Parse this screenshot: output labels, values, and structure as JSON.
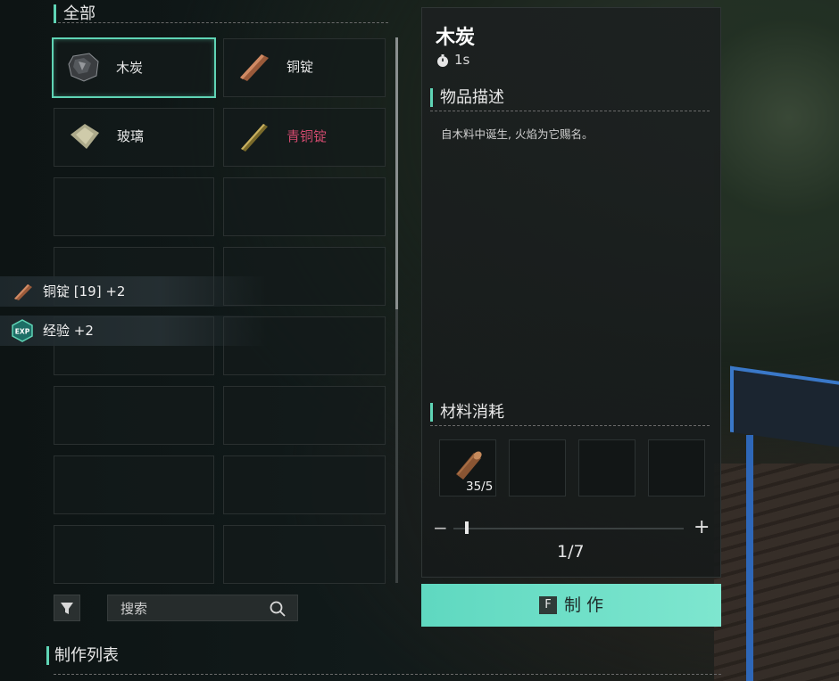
{
  "category": {
    "title": "全部"
  },
  "items": [
    {
      "label": "木炭",
      "icon": "charcoal-icon",
      "selected": true,
      "color": "#e6e6e6"
    },
    {
      "label": "铜锭",
      "icon": "copper-ingot-icon",
      "selected": false,
      "color": "#e6e6e6"
    },
    {
      "label": "玻璃",
      "icon": "glass-icon",
      "selected": false,
      "color": "#e6e6e6"
    },
    {
      "label": "青铜锭",
      "icon": "bronze-ingot-icon",
      "selected": false,
      "color": "#d14a6e"
    }
  ],
  "notifications": [
    {
      "icon": "copper-ingot-icon",
      "text": "铜锭 [19] +2"
    },
    {
      "icon": "exp-icon",
      "icon_text": "EXP",
      "text": "经验 +2"
    }
  ],
  "search": {
    "placeholder": "搜索"
  },
  "craft_list": {
    "title": "制作列表"
  },
  "detail": {
    "name": "木炭",
    "time": "1s",
    "desc_title": "物品描述",
    "description": "自木料中诞生, 火焰为它赐名。",
    "materials_title": "材料消耗",
    "materials": [
      {
        "icon": "wood-log-icon",
        "count": "35/5"
      }
    ],
    "quantity": "1/7",
    "qty_minus": "−",
    "qty_plus": "+"
  },
  "craft_button": {
    "key": "F",
    "label": "制作"
  },
  "colors": {
    "accent": "#5fd4b5",
    "rare": "#d14a6e",
    "button": "#6fdfc6"
  }
}
